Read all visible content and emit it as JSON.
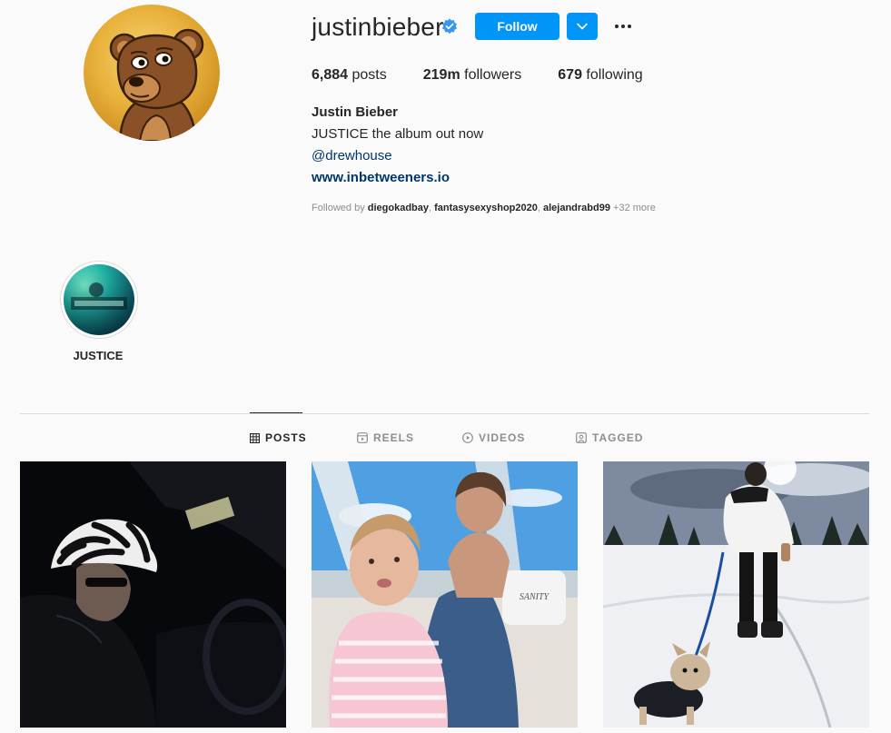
{
  "profile": {
    "username": "justinbieber",
    "follow_label": "Follow",
    "stats": {
      "posts_count": "6,884",
      "posts_label": "posts",
      "followers_count": "219m",
      "followers_label": "followers",
      "following_count": "679",
      "following_label": "following"
    },
    "bio": {
      "full_name": "Justin Bieber",
      "line": "JUSTICE the album out now",
      "mention": "@drewhouse",
      "website": "www.inbetweeners.io"
    },
    "followed_by": {
      "prefix": "Followed by",
      "user1": "diegokadbay",
      "user2": "fantasysexyshop2020",
      "user3": "alejandrabd99",
      "more": "+32 more"
    }
  },
  "highlights": [
    {
      "label": "JUSTICE"
    }
  ],
  "tabs": [
    {
      "label": "POSTS",
      "icon": "grid-icon",
      "active": true
    },
    {
      "label": "REELS",
      "icon": "reels-icon",
      "active": false
    },
    {
      "label": "VIDEOS",
      "icon": "play-circle-icon",
      "active": false
    },
    {
      "label": "TAGGED",
      "icon": "tag-person-icon",
      "active": false
    }
  ],
  "posts": [
    {
      "description_icon": "photo-dark-car"
    },
    {
      "description_icon": "photo-boat-kids",
      "boat_text": "SANITY"
    },
    {
      "description_icon": "photo-snow-dog"
    }
  ],
  "colors": {
    "accent": "#0095f6",
    "link": "#00376b",
    "background": "#fafafa",
    "text": "#262626",
    "secondary_text": "#8e8e8e"
  }
}
